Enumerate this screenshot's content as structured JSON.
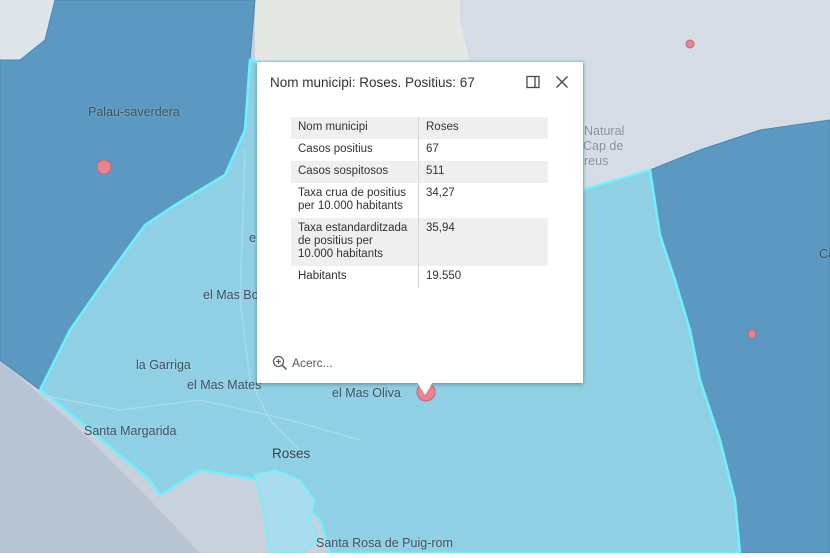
{
  "map": {
    "labels": {
      "palau": "Palau-saverdera",
      "natural": "Natural",
      "cap_de": "Cap de",
      "creus": "reus",
      "e_frag": "e",
      "ca_frag": "Ca",
      "mas_bo": "el Mas Bo",
      "garriga": "la Garriga",
      "mas_mates": "el Mas Mates",
      "mas_oliva": "el Mas Oliva",
      "santa_margarida": "Santa Margarida",
      "roses": "Roses",
      "santa_rosa": "Santa Rosa de Puig-rom"
    },
    "colors": {
      "municipality_dark": "#5b99c2",
      "municipality_selected": "#8fd0e4",
      "highlight_outline": "#6ff0ff",
      "land": "#d3dae3",
      "sea": "#c7cfdc",
      "case_marker": "#e8848f"
    }
  },
  "popup": {
    "title": "Nom municipi: Roses. Positius: 67",
    "dock_icon": "dock-icon",
    "close_icon": "close-icon",
    "rows": [
      {
        "field": "Nom municipi",
        "value": "Roses"
      },
      {
        "field": "Casos positius",
        "value": "67"
      },
      {
        "field": "Casos sospitosos",
        "value": "511"
      },
      {
        "field": "Taxa crua de positius per 10.000 habitants",
        "value": "34,27"
      },
      {
        "field": "Taxa estandarditzada de positius per 10.000 habitants",
        "value": "35,94"
      },
      {
        "field": "Habitants",
        "value": "19.550"
      }
    ],
    "zoom_label": "Acerc...",
    "zoom_icon": "zoom-in-icon"
  }
}
